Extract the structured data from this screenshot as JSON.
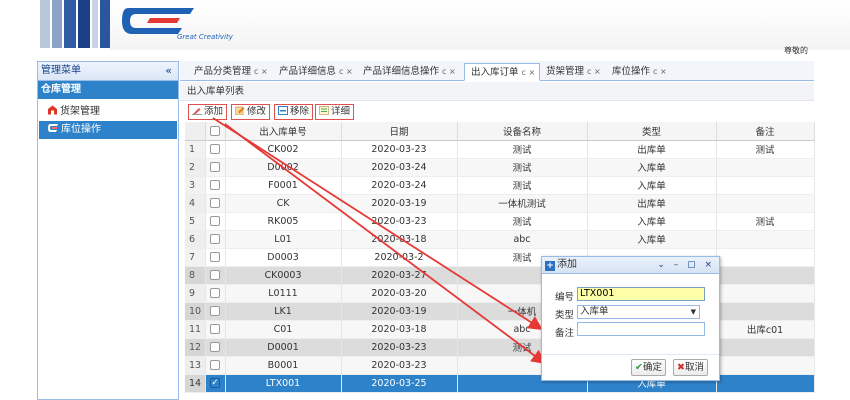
{
  "header": {
    "logo_text": "Great Creativity",
    "welcome_text": "尊敬的"
  },
  "colors": {
    "accent": "#2e82c9",
    "brand": "#1f61b5",
    "annotation_arrow": "#e53935"
  },
  "sidebar": {
    "title": "管理菜单",
    "collapse_icon": "«",
    "group": "仓库管理",
    "items": [
      {
        "label": "货架管理",
        "icon": "shelf-icon"
      },
      {
        "label": "库位操作",
        "icon": "location-icon"
      }
    ]
  },
  "tabs": [
    {
      "label": "产品分类管理",
      "close": "c ×"
    },
    {
      "label": "产品详细信息",
      "close": "c ×"
    },
    {
      "label": "产品详细信息操作",
      "close": "c ×"
    },
    {
      "label": "出入库订单",
      "close": "c ×"
    },
    {
      "label": "货架管理",
      "close": "c ×"
    },
    {
      "label": "库位操作",
      "close": "c ×"
    }
  ],
  "panel": {
    "title": "出入库单列表"
  },
  "toolbar": {
    "add": "添加",
    "edit": "修改",
    "remove": "移除",
    "detail": "详细"
  },
  "grid": {
    "columns": [
      "出入库单号",
      "日期",
      "设备名称",
      "类型",
      "备注"
    ],
    "rows": [
      {
        "num": "1",
        "code": "CK002",
        "date": "2020-03-23",
        "device": "测试",
        "type": "出库单",
        "note": "测试"
      },
      {
        "num": "2",
        "code": "D0002",
        "date": "2020-03-24",
        "device": "测试",
        "type": "入库单",
        "note": ""
      },
      {
        "num": "3",
        "code": "F0001",
        "date": "2020-03-24",
        "device": "测试",
        "type": "入库单",
        "note": ""
      },
      {
        "num": "4",
        "code": "CK",
        "date": "2020-03-19",
        "device": "一体机测试",
        "type": "出库单",
        "note": ""
      },
      {
        "num": "5",
        "code": "RK005",
        "date": "2020-03-23",
        "device": "测试",
        "type": "入库单",
        "note": "测试"
      },
      {
        "num": "6",
        "code": "L01",
        "date": "2020-03-18",
        "device": "abc",
        "type": "入库单",
        "note": ""
      },
      {
        "num": "7",
        "code": "D0003",
        "date": "2020-03-2",
        "device": "测试",
        "type": "",
        "note": ""
      },
      {
        "num": "8",
        "code": "CK0003",
        "date": "2020-03-27",
        "device": "",
        "type": "",
        "note": ""
      },
      {
        "num": "9",
        "code": "L0111",
        "date": "2020-03-20",
        "device": "",
        "type": "",
        "note": ""
      },
      {
        "num": "10",
        "code": "LK1",
        "date": "2020-03-19",
        "device": "一体机",
        "type": "",
        "note": ""
      },
      {
        "num": "11",
        "code": "C01",
        "date": "2020-03-18",
        "device": "abc",
        "type": "",
        "note": "出库c01"
      },
      {
        "num": "12",
        "code": "D0001",
        "date": "2020-03-23",
        "device": "测试",
        "type": "",
        "note": ""
      },
      {
        "num": "13",
        "code": "B0001",
        "date": "2020-03-23",
        "device": "",
        "type": "",
        "note": ""
      },
      {
        "num": "14",
        "code": "LTX001",
        "date": "2020-03-25",
        "device": "",
        "type": "入库单",
        "note": ""
      }
    ]
  },
  "dialog": {
    "title": "添加",
    "tool_icons": "⌄ – ▢ ×",
    "code_label": "编号",
    "code_value": "LTX001",
    "type_label": "类型",
    "type_value": "入库单",
    "note_label": "备注",
    "note_value": "",
    "ok": "确定",
    "cancel": "取消"
  }
}
